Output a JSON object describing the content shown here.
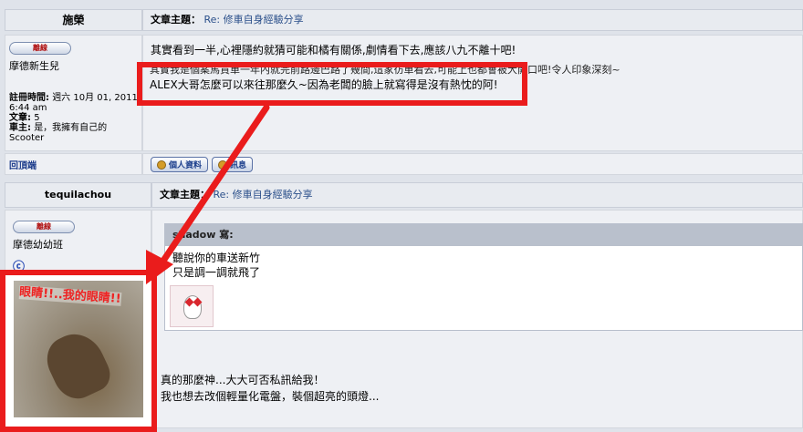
{
  "post1": {
    "username": "施榮",
    "topic_label": "文章主題：",
    "topic_value": "Re: 修車自身經驗分享",
    "status_button": "離線",
    "rank": "摩德新生兒",
    "reg_label": "註冊時間:",
    "reg_value": "週六 10月 01, 2011 6:44 am",
    "posts_label": "文章:",
    "posts_value": "5",
    "vehicle_label": "車主:",
    "vehicle_value": "是，我擁有自己的 Scooter",
    "body_line1": "其實看到一半,心裡隱約就猜可能和橘有關係,劇情看下去,應該八九不離十吧!",
    "body_line2": "其實我是個案馬貫單一年內就完前路邊巴路了幾間,這家彷單看去,可能上也都會被大開口吧!令人印象深刻~",
    "body_line3": "ALEX大哥怎麼可以來往那麼久~因為老闆的臉上就寫得是沒有熱忱的阿!",
    "back_to_top": "回頂端",
    "profile_button": "個人資料",
    "message_button": "訊息"
  },
  "post2": {
    "username": "tequilachou",
    "topic_label": "文章主題：",
    "topic_value": "Re: 修車自身經驗分享",
    "status_button": "離線",
    "rank": "摩德幼幼班",
    "quote_author": "shadow 寫:",
    "quote_line1": "聽說你的車送新竹",
    "quote_line2": "只是調一調就飛了",
    "avatar_caption": "眼睛!!..我的眼睛!!",
    "body_line1": "真的那麼神...大大可否私訊給我！",
    "body_line2": "我也想去改個輕量化電盤，裝個超亮的頭燈..."
  },
  "colors": {
    "annotation_red": "#ea1c1c",
    "link_blue": "#2a4f8a",
    "panel_bg": "#eef0f4"
  }
}
